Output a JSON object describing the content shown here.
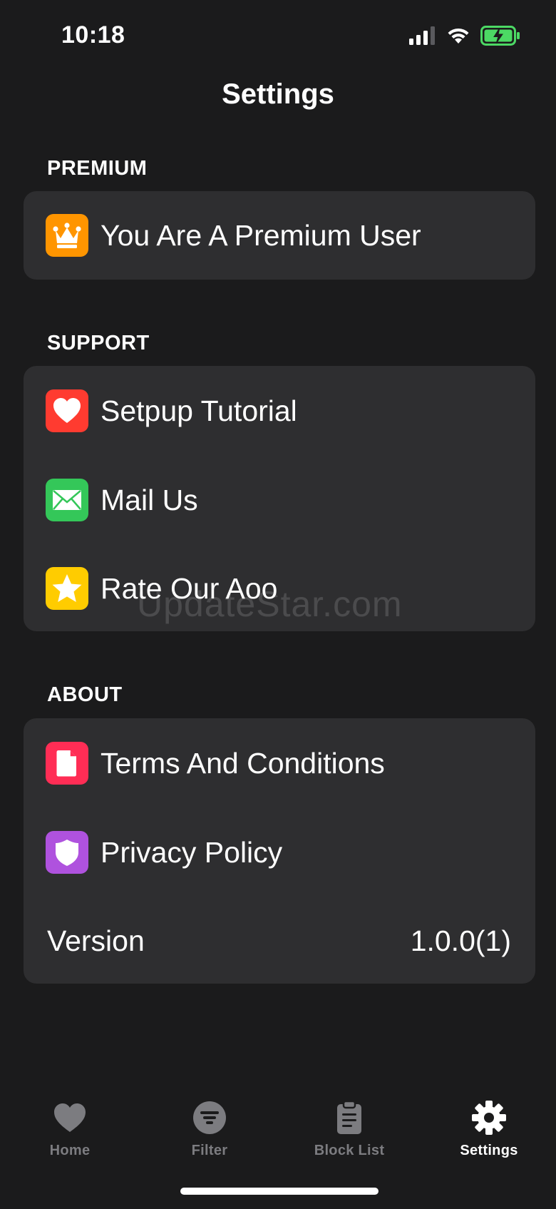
{
  "status_bar": {
    "time": "10:18",
    "icons": [
      "cellular-signal-icon",
      "wifi-icon",
      "battery-charging-icon"
    ],
    "battery_color": "#4cd964"
  },
  "nav": {
    "title": "Settings"
  },
  "sections": {
    "premium": {
      "header": "PREMIUM",
      "rows": [
        {
          "label": "You Are A Premium User",
          "icon": "crown-icon",
          "icon_color": "#ff9500"
        }
      ]
    },
    "support": {
      "header": "SUPPORT",
      "rows": [
        {
          "label": "Setpup Tutorial",
          "icon": "heart-icon",
          "icon_color": "#ff3b30"
        },
        {
          "label": "Mail Us",
          "icon": "mail-icon",
          "icon_color": "#34c759"
        },
        {
          "label": "Rate Our Aoo",
          "icon": "star-icon",
          "icon_color": "#ffcc00"
        }
      ]
    },
    "about": {
      "header": "ABOUT",
      "rows": [
        {
          "label": "Terms And Conditions",
          "icon": "document-icon",
          "icon_color": "#ff2d55"
        },
        {
          "label": "Privacy Policy",
          "icon": "shield-icon",
          "icon_color": "#af52de"
        }
      ],
      "version": {
        "label": "Version",
        "value": "1.0.0(1)"
      }
    }
  },
  "watermark": "UpdateStar.com",
  "tab_bar": {
    "selected": "Settings",
    "tabs": [
      {
        "label": "Home",
        "icon": "heart-icon"
      },
      {
        "label": "Filter",
        "icon": "filter-icon"
      },
      {
        "label": "Block List",
        "icon": "clipboard-icon"
      },
      {
        "label": "Settings",
        "icon": "gear-icon"
      }
    ]
  }
}
